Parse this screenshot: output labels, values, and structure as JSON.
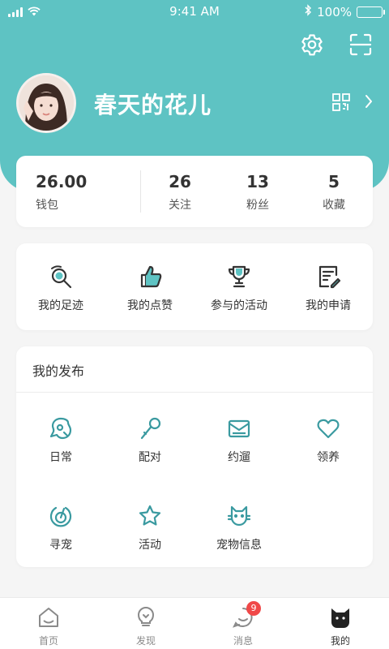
{
  "status_bar": {
    "time": "9:41 AM",
    "battery": "100%"
  },
  "profile": {
    "username": "春天的花儿"
  },
  "stats": {
    "wallet": {
      "value": "26.00",
      "label": "钱包"
    },
    "items": [
      {
        "value": "26",
        "label": "关注"
      },
      {
        "value": "13",
        "label": "粉丝"
      },
      {
        "value": "5",
        "label": "收藏"
      }
    ]
  },
  "menu": [
    {
      "label": "我的足迹",
      "icon": "footprint-icon"
    },
    {
      "label": "我的点赞",
      "icon": "thumbs-up-icon"
    },
    {
      "label": "参与的活动",
      "icon": "trophy-icon"
    },
    {
      "label": "我的申请",
      "icon": "application-icon"
    }
  ],
  "publish": {
    "title": "我的发布",
    "items": [
      {
        "label": "日常",
        "icon": "daily-icon"
      },
      {
        "label": "配对",
        "icon": "pairing-icon"
      },
      {
        "label": "约遛",
        "icon": "walk-date-icon"
      },
      {
        "label": "领养",
        "icon": "heart-icon"
      },
      {
        "label": "寻宠",
        "icon": "find-pet-icon"
      },
      {
        "label": "活动",
        "icon": "star-icon"
      },
      {
        "label": "宠物信息",
        "icon": "pet-info-icon"
      }
    ]
  },
  "tabbar": {
    "items": [
      {
        "label": "首页",
        "icon": "home-icon"
      },
      {
        "label": "发现",
        "icon": "discover-icon"
      },
      {
        "label": "消息",
        "icon": "message-icon",
        "badge": "9"
      },
      {
        "label": "我的",
        "icon": "profile-cat-icon"
      }
    ],
    "active": "我的"
  },
  "colors": {
    "accent": "#5ec3c3",
    "icon_teal": "#3a9aa0",
    "badge": "#f04848"
  }
}
